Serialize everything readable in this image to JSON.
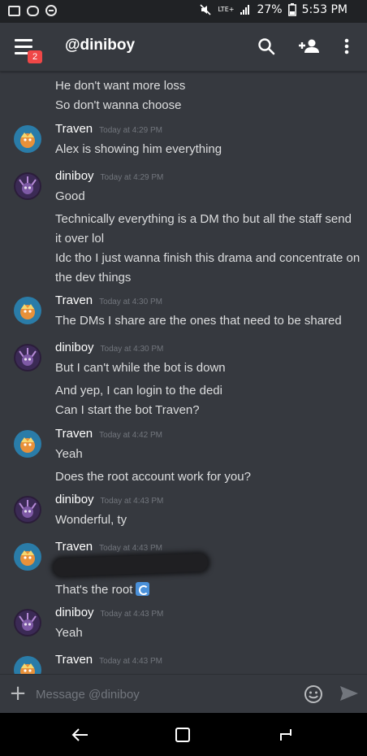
{
  "status_bar": {
    "network": "LTE+",
    "battery": "27%",
    "time": "5:53 PM",
    "icons": [
      "gallery-icon",
      "game-icon",
      "blocked-icon",
      "mute-icon",
      "signal-icon",
      "battery-icon"
    ]
  },
  "header": {
    "title": "@diniboy",
    "badge": "2",
    "icons": [
      "menu-icon",
      "search-icon",
      "add-friend-icon",
      "more-vert-icon"
    ]
  },
  "messages": [
    {
      "author": null,
      "lines": [
        "He don't want more loss",
        "So don't wanna choose"
      ]
    },
    {
      "author": "Traven",
      "time": "Today at 4:29 PM",
      "lines": [
        "Alex is showing him everything"
      ]
    },
    {
      "author": "diniboy",
      "time": "Today at 4:29 PM",
      "lines": [
        "Good",
        "Technically everything is a DM tho but all the staff send it over lol",
        "Idc tho I just wanna finish this drama and concentrate on the dev things"
      ]
    },
    {
      "author": "Traven",
      "time": "Today at 4:30 PM",
      "lines": [
        "The DMs I share are the ones that need to be shared"
      ]
    },
    {
      "author": "diniboy",
      "time": "Today at 4:30 PM",
      "lines": [
        "But I can't while the bot is down",
        "And yep, I can login to the dedi",
        "Can I start the bot Traven?"
      ]
    },
    {
      "author": "Traven",
      "time": "Today at 4:42 PM",
      "lines": [
        "Yeah",
        "Does the root account work for you?"
      ]
    },
    {
      "author": "diniboy",
      "time": "Today at 4:43 PM",
      "lines": [
        "Wonderful, ty"
      ]
    },
    {
      "author": "Traven",
      "time": "Today at 4:43 PM",
      "lines": [
        "That's the root"
      ],
      "emoji": "repeat-emoji-icon"
    },
    {
      "author": "diniboy",
      "time": "Today at 4:43 PM",
      "lines": [
        "Yeah"
      ]
    },
    {
      "author": "Traven",
      "time": "Today at 4:43 PM",
      "lines": []
    }
  ],
  "input": {
    "placeholder": "Message @diniboy"
  },
  "nav": {
    "icons": [
      "back-icon",
      "recents-icon",
      "home-icon"
    ]
  },
  "colors": {
    "background": "#36393f",
    "status_bar": "#202225",
    "badge": "#f04747",
    "timestamp": "#72767d",
    "text": "#dcddde"
  }
}
